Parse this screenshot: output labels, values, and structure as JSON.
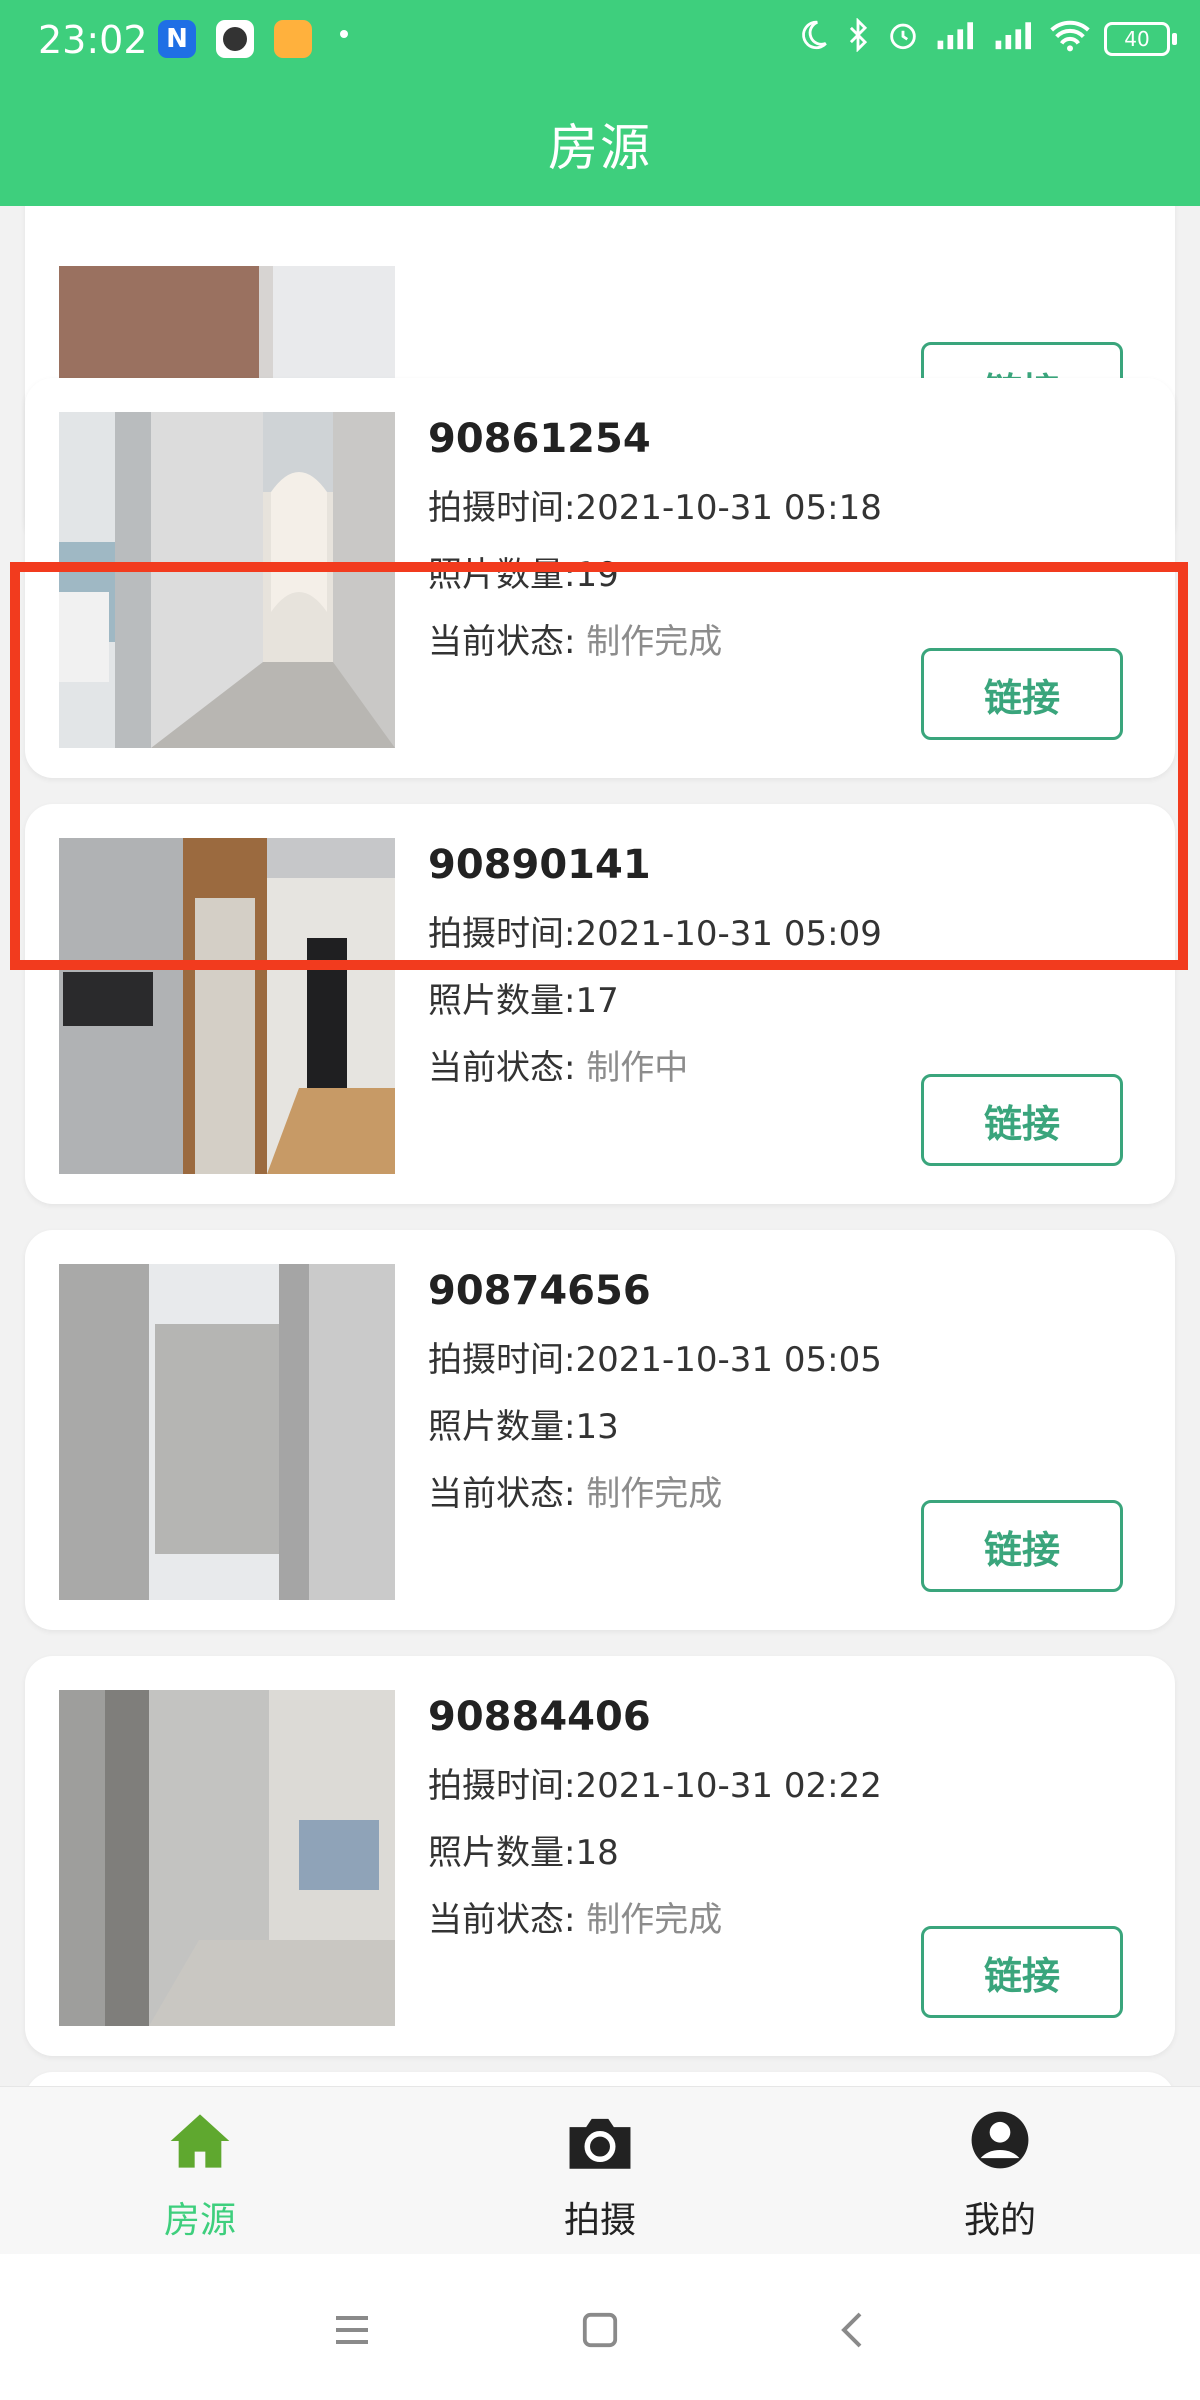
{
  "status_bar": {
    "time": "23:02",
    "app_n": "N",
    "battery": "40",
    "icons": [
      "moon-icon",
      "bluetooth-icon",
      "alarm-icon",
      "hd-signal-icon",
      "signal-icon",
      "wifi-icon",
      "battery-icon"
    ]
  },
  "header": {
    "title": "房源"
  },
  "link_label": "链接",
  "labels": {
    "time_prefix": "拍摄时间:",
    "count_prefix": "照片数量:",
    "status_prefix": "当前状态: "
  },
  "listings": [
    {
      "id": "90861254",
      "time": "2021-10-31 05:18",
      "count": "19",
      "status": "制作完成",
      "selected": true
    },
    {
      "id": "90890141",
      "time": "2021-10-31 05:09",
      "count": "17",
      "status": "制作中"
    },
    {
      "id": "90874656",
      "time": "2021-10-31 05:05",
      "count": "13",
      "status": "制作完成"
    },
    {
      "id": "90884406",
      "time": "2021-10-31 02:22",
      "count": "18",
      "status": "制作完成"
    }
  ],
  "bottom_nav": [
    {
      "label": "房源",
      "icon": "home-icon",
      "active": true
    },
    {
      "label": "拍摄",
      "icon": "camera-icon"
    },
    {
      "label": "我的",
      "icon": "user-icon"
    }
  ],
  "system_nav": [
    "menu-icon",
    "home-square-icon",
    "back-icon"
  ],
  "colors": {
    "primary": "#3ecf7d",
    "button": "#3aa57c",
    "highlight": "#f23b1e"
  }
}
